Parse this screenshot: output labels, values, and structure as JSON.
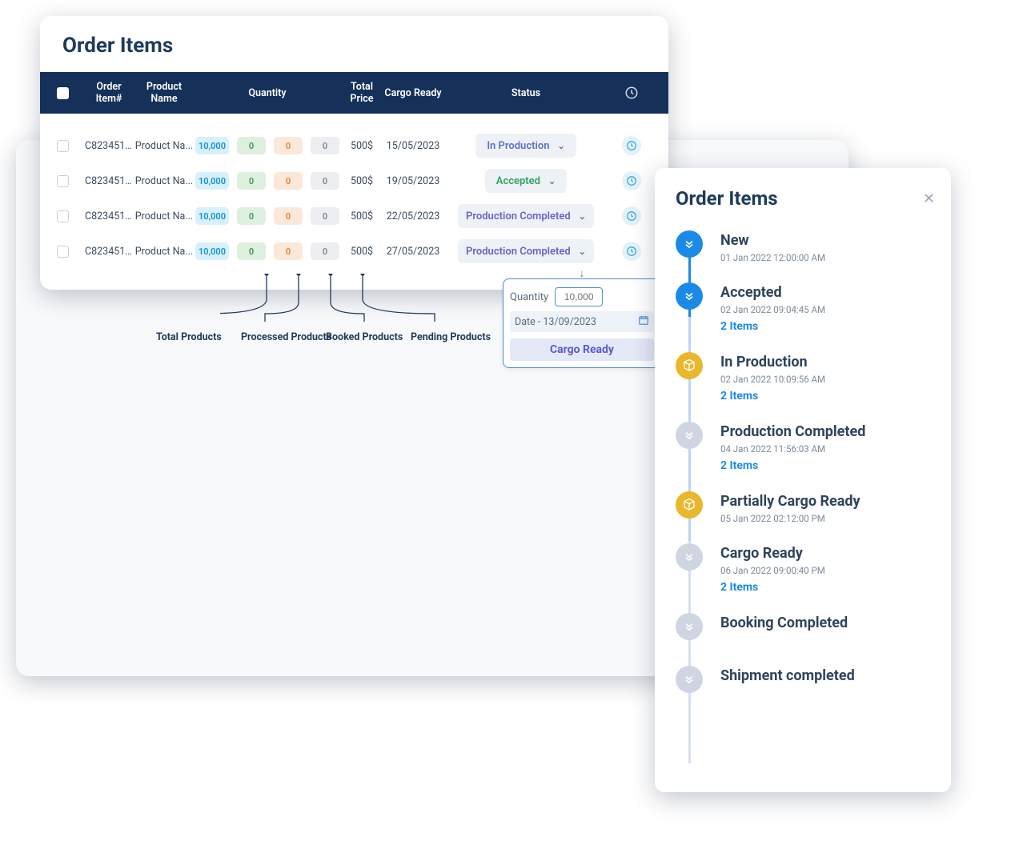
{
  "main": {
    "title": "Order Items",
    "columns": {
      "id": "Order Item#",
      "name": "Product Name",
      "qty": "Quantity",
      "price": "Total Price",
      "cargo": "Cargo Ready",
      "status": "Status"
    },
    "rows": [
      {
        "id": "C823451...",
        "name": "Product Na...",
        "q1": "10,000",
        "q2": "0",
        "q3": "0",
        "q4": "0",
        "price": "500$",
        "cargo": "15/05/2023",
        "status": "In Production",
        "stClass": "st-prod"
      },
      {
        "id": "C823451...",
        "name": "Product Na...",
        "q1": "10,000",
        "q2": "0",
        "q3": "0",
        "q4": "0",
        "price": "500$",
        "cargo": "19/05/2023",
        "status": "Accepted",
        "stClass": "st-accept"
      },
      {
        "id": "C823451...",
        "name": "Product Na...",
        "q1": "10,000",
        "q2": "0",
        "q3": "0",
        "q4": "0",
        "price": "500$",
        "cargo": "22/05/2023",
        "status": "Production Completed",
        "stClass": "st-pcomp"
      },
      {
        "id": "C823451...",
        "name": "Product Na...",
        "q1": "10,000",
        "q2": "0",
        "q3": "0",
        "q4": "0",
        "price": "500$",
        "cargo": "27/05/2023",
        "status": "Production Completed",
        "stClass": "st-pcomp"
      }
    ],
    "annotations": {
      "total": "Total Products",
      "processed": "Processed Products",
      "booked": "Booked Products",
      "pending": "Pending Products"
    },
    "popover": {
      "qty_label": "Quantity",
      "qty_placeholder": "10,000",
      "date_text": "Date - 13/09/2023",
      "button": "Cargo Ready"
    }
  },
  "timeline": {
    "title": "Order Items",
    "steps": [
      {
        "name": "New",
        "time": "01 Jan 2022 12:00:00 AM",
        "items": "",
        "dot": "dot-blue",
        "icon": "chevrons"
      },
      {
        "name": "Accepted",
        "time": "02 Jan 2022 09:04:45 AM",
        "items": "2 Items",
        "dot": "dot-blue",
        "icon": "chevrons"
      },
      {
        "name": "In Production",
        "time": "02 Jan 2022 10:09:56 AM",
        "items": "2 Items",
        "dot": "dot-yellow",
        "icon": "box"
      },
      {
        "name": "Production Completed",
        "time": "04 Jan 2022 11:56:03 AM",
        "items": "2 Items",
        "dot": "dot-gray",
        "icon": "chevrons"
      },
      {
        "name": "Partially Cargo Ready",
        "time": "05 Jan 2022 02:12:00 PM",
        "items": "",
        "dot": "dot-yellow",
        "icon": "box"
      },
      {
        "name": "Cargo Ready",
        "time": "06 Jan 2022 09:00:40 PM",
        "items": "2 Items",
        "dot": "dot-gray",
        "icon": "chevrons"
      },
      {
        "name": "Booking Completed",
        "time": "",
        "items": "",
        "dot": "dot-gray",
        "icon": "chevrons"
      },
      {
        "name": "Shipment completed",
        "time": "",
        "items": "",
        "dot": "dot-gray",
        "icon": "chevrons"
      }
    ]
  }
}
